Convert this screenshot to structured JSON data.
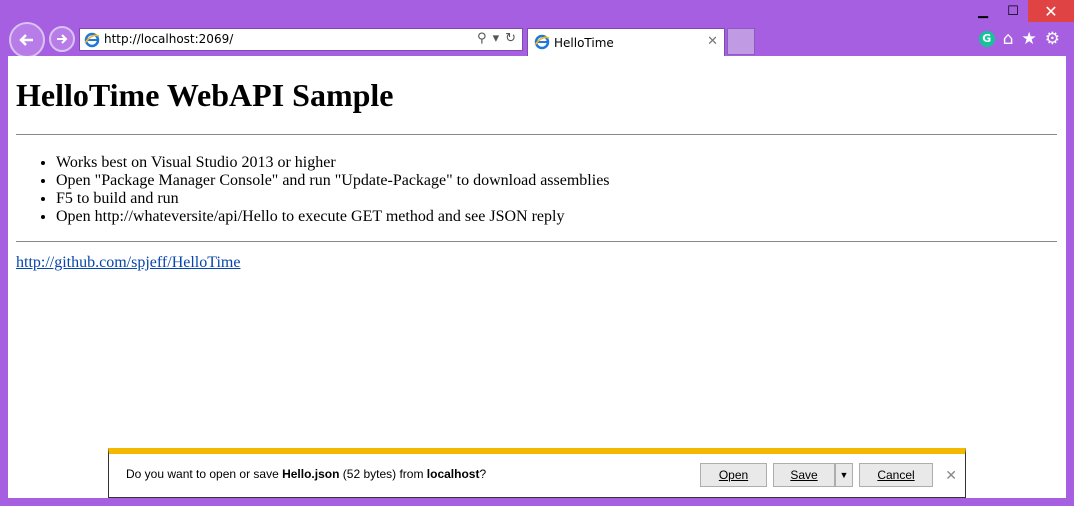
{
  "browser": {
    "url": "http://localhost:2069/",
    "tab_title": "HelloTime",
    "accent_color": "#a55fe0"
  },
  "page": {
    "title": "HelloTime WebAPI Sample",
    "items": [
      "Works best on Visual Studio 2013 or higher",
      "Open \"Package Manager Console\" and run \"Update-Package\" to download assemblies",
      "F5 to build and run",
      "Open http://whateversite/api/Hello to execute GET method and see JSON reply"
    ],
    "link_text": "http://github.com/spjeff/HelloTime"
  },
  "download_bar": {
    "prefix": "Do you want to open or save ",
    "filename": "Hello.json",
    "size": " (52 bytes) from ",
    "host": "localhost",
    "suffix": "?",
    "open_label": "Open",
    "save_label": "Save",
    "cancel_label": "Cancel"
  }
}
